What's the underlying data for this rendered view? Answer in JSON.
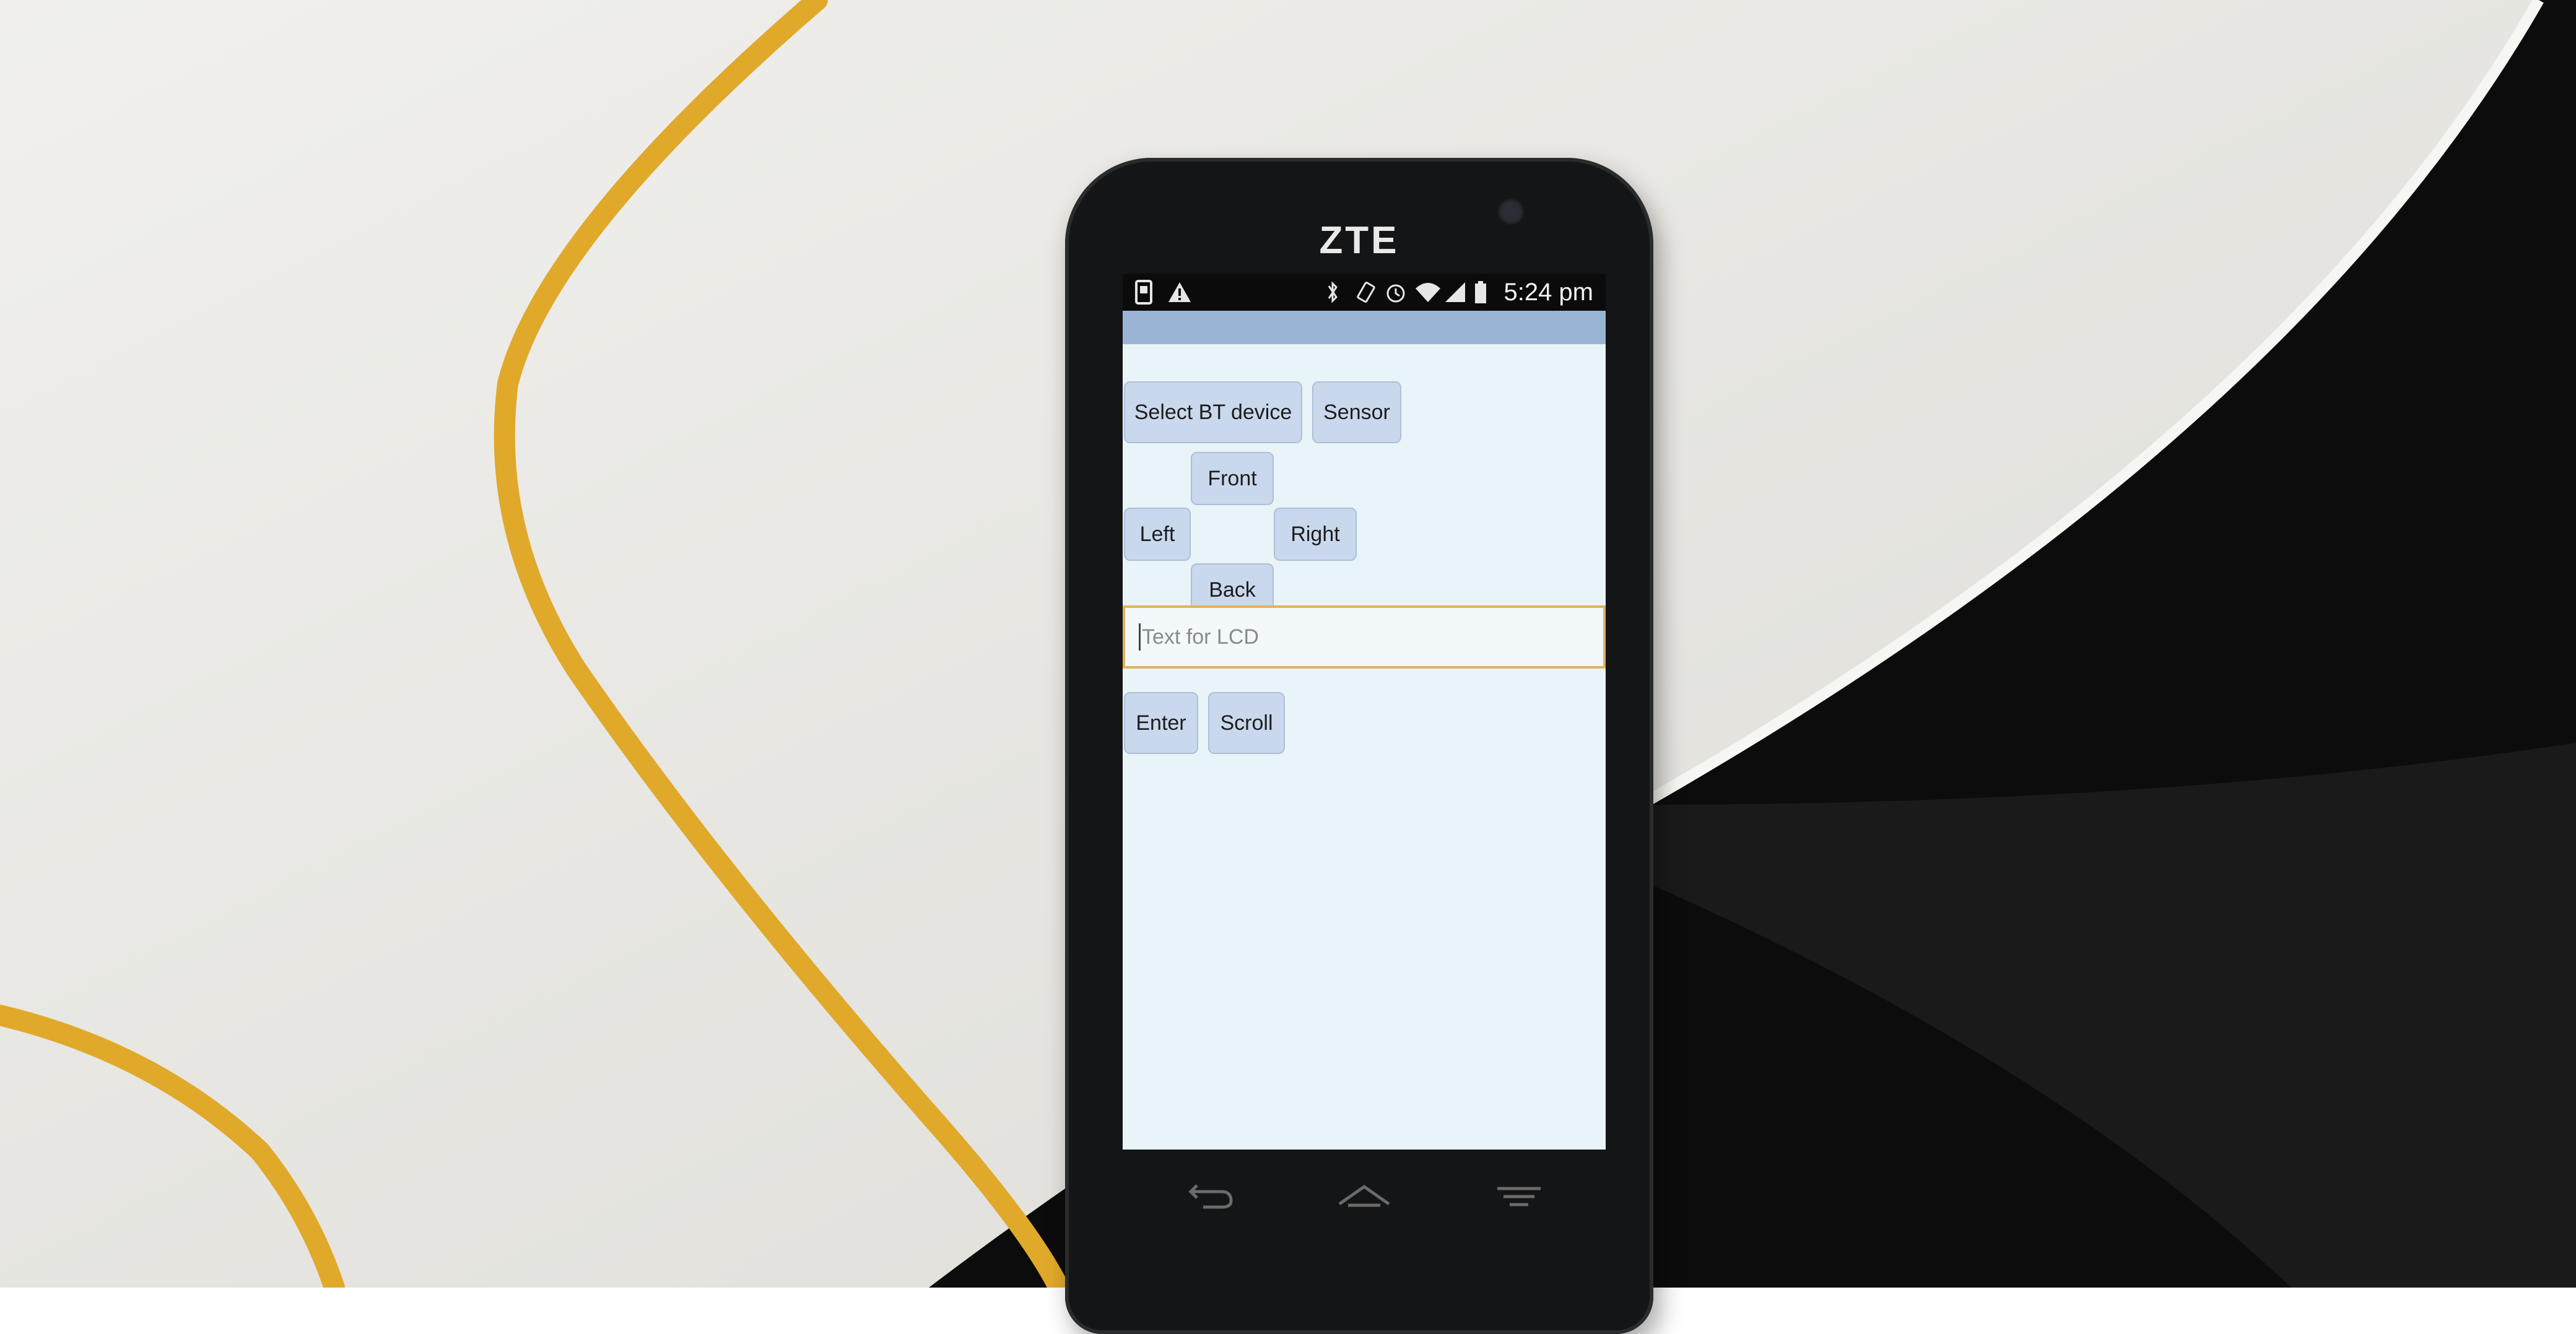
{
  "phone": {
    "brand": "ZTE"
  },
  "statusbar": {
    "left_icons": [
      "download-icon",
      "warning-icon"
    ],
    "right_icons": [
      "bluetooth-icon",
      "rotate-icon",
      "alarm-icon",
      "wifi-icon",
      "signal-icon",
      "battery-icon"
    ],
    "time": "5:24 pm"
  },
  "app": {
    "buttons": {
      "select_bt_device": "Select BT device",
      "sensor": "Sensor",
      "front": "Front",
      "left": "Left",
      "right": "Right",
      "back": "Back",
      "enter": "Enter",
      "scroll": "Scroll"
    },
    "lcd_input": {
      "placeholder": "Text for LCD",
      "value": ""
    }
  },
  "navbar": {
    "icons": [
      "back-icon",
      "home-icon",
      "menu-icon"
    ]
  },
  "colors": {
    "screen_bg": "#e8f4f8",
    "titlebar": "#9ab4d6",
    "button_bg": "#c9d8ec",
    "input_border": "#e0b35a",
    "cable": "#e0a92a",
    "table": "#ecebe6"
  }
}
